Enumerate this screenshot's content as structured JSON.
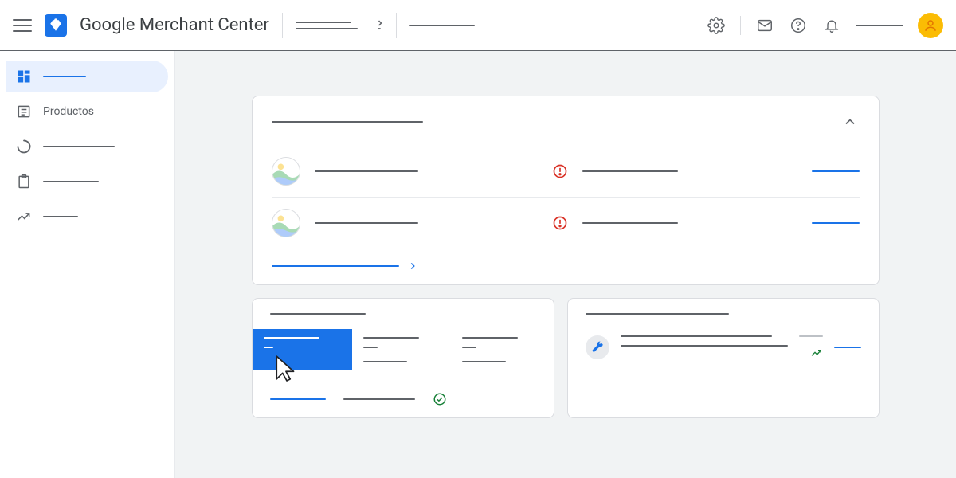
{
  "header": {
    "app_title": "Google Merchant Center",
    "account_selector": "",
    "secondary_selector": ""
  },
  "sidebar": {
    "items": [
      {
        "id": "overview",
        "label": "",
        "active": true
      },
      {
        "id": "products",
        "label": "Productos",
        "active": false
      },
      {
        "id": "performance",
        "label": "",
        "active": false
      },
      {
        "id": "marketing",
        "label": "",
        "active": false
      },
      {
        "id": "growth",
        "label": "",
        "active": false
      }
    ]
  },
  "main_card": {
    "title": "",
    "rows": [
      {
        "name": "",
        "status": "",
        "action": ""
      },
      {
        "name": "",
        "status": "",
        "action": ""
      }
    ],
    "footer_link": ""
  },
  "left_card": {
    "title": "",
    "tiles": [
      {
        "k": "",
        "v": ""
      },
      {
        "k": "",
        "v": ""
      },
      {
        "k": "",
        "v": ""
      }
    ],
    "footer_link": "",
    "footer_metric": "",
    "footer_status": ""
  },
  "right_card": {
    "title": "",
    "line1": "",
    "line2": "",
    "badge": "",
    "action": ""
  },
  "colors": {
    "primary": "#1a73e8",
    "danger": "#d93025",
    "success": "#188038",
    "avatar": "#fbbc04"
  }
}
